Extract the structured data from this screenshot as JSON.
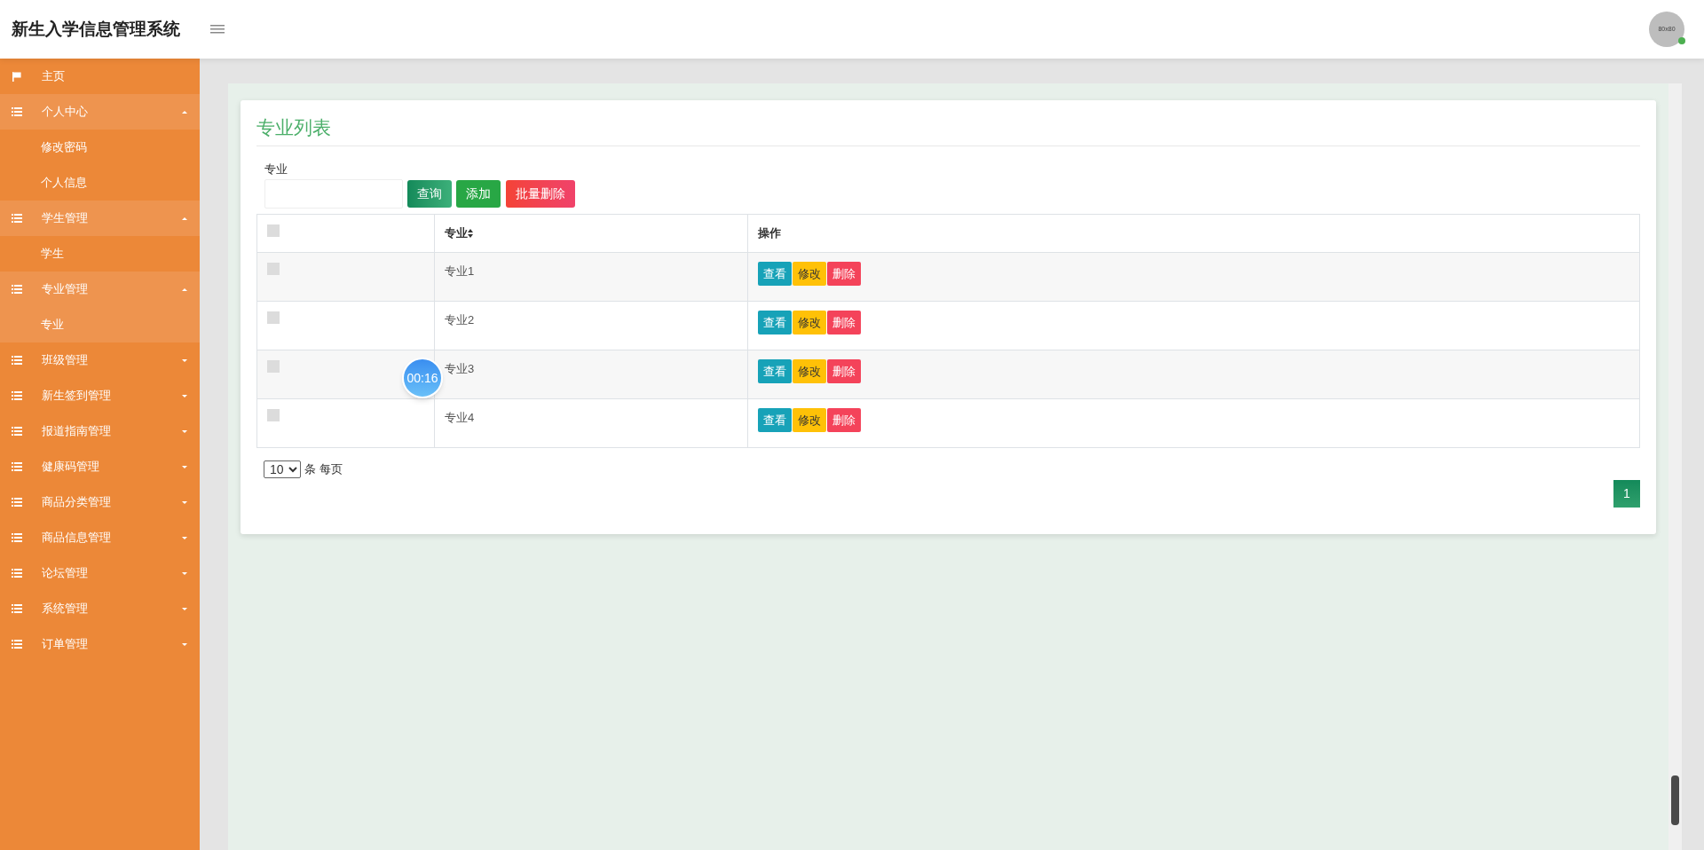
{
  "header": {
    "title": "新生入学信息管理系统",
    "avatar_text": "80x80",
    "online": true
  },
  "sidebar": {
    "items": [
      {
        "label": "主页",
        "kind": "home",
        "expanded": false
      },
      {
        "label": "个人中心",
        "kind": "group",
        "expanded": true,
        "children": [
          {
            "label": "修改密码",
            "selected": false
          },
          {
            "label": "个人信息",
            "selected": false
          }
        ]
      },
      {
        "label": "学生管理",
        "kind": "group",
        "expanded": true,
        "children": [
          {
            "label": "学生",
            "selected": false
          }
        ]
      },
      {
        "label": "专业管理",
        "kind": "group",
        "expanded": true,
        "children": [
          {
            "label": "专业",
            "selected": true
          }
        ]
      },
      {
        "label": "班级管理",
        "kind": "group",
        "expanded": false
      },
      {
        "label": "新生签到管理",
        "kind": "group",
        "expanded": false
      },
      {
        "label": "报道指南管理",
        "kind": "group",
        "expanded": false
      },
      {
        "label": "健康码管理",
        "kind": "group",
        "expanded": false
      },
      {
        "label": "商品分类管理",
        "kind": "group",
        "expanded": false
      },
      {
        "label": "商品信息管理",
        "kind": "group",
        "expanded": false
      },
      {
        "label": "论坛管理",
        "kind": "group",
        "expanded": false
      },
      {
        "label": "系统管理",
        "kind": "group",
        "expanded": false
      },
      {
        "label": "订单管理",
        "kind": "group",
        "expanded": false
      }
    ]
  },
  "card": {
    "title": "专业列表",
    "search": {
      "label": "专业"
    },
    "buttons": [
      {
        "label": "查询",
        "kind": "query"
      },
      {
        "label": "添加",
        "kind": "add"
      },
      {
        "label": "批量删除",
        "kind": "delete"
      }
    ],
    "table": {
      "select_all_checked": false,
      "columns": [
        "专业",
        "操作"
      ],
      "rows": [
        {
          "checked": false,
          "name": "专业1",
          "actions": [
            {
              "label": "查看",
              "kind": "view"
            },
            {
              "label": "修改",
              "kind": "edit"
            },
            {
              "label": "删除",
              "kind": "delete"
            }
          ]
        },
        {
          "checked": false,
          "name": "专业2",
          "actions": [
            {
              "label": "查看",
              "kind": "view"
            },
            {
              "label": "修改",
              "kind": "edit"
            },
            {
              "label": "删除",
              "kind": "delete"
            }
          ]
        },
        {
          "checked": false,
          "name": "专业3",
          "actions": [
            {
              "label": "查看",
              "kind": "view"
            },
            {
              "label": "修改",
              "kind": "edit"
            },
            {
              "label": "删除",
              "kind": "delete"
            }
          ]
        },
        {
          "checked": false,
          "name": "专业4",
          "actions": [
            {
              "label": "查看",
              "kind": "view"
            },
            {
              "label": "修改",
              "kind": "edit"
            },
            {
              "label": "删除",
              "kind": "delete"
            }
          ]
        }
      ]
    },
    "page_size": {
      "value": "10",
      "suffix": "条 每页"
    },
    "pages": [
      {
        "label": "1",
        "selected": true
      }
    ]
  },
  "timer": "00:16"
}
